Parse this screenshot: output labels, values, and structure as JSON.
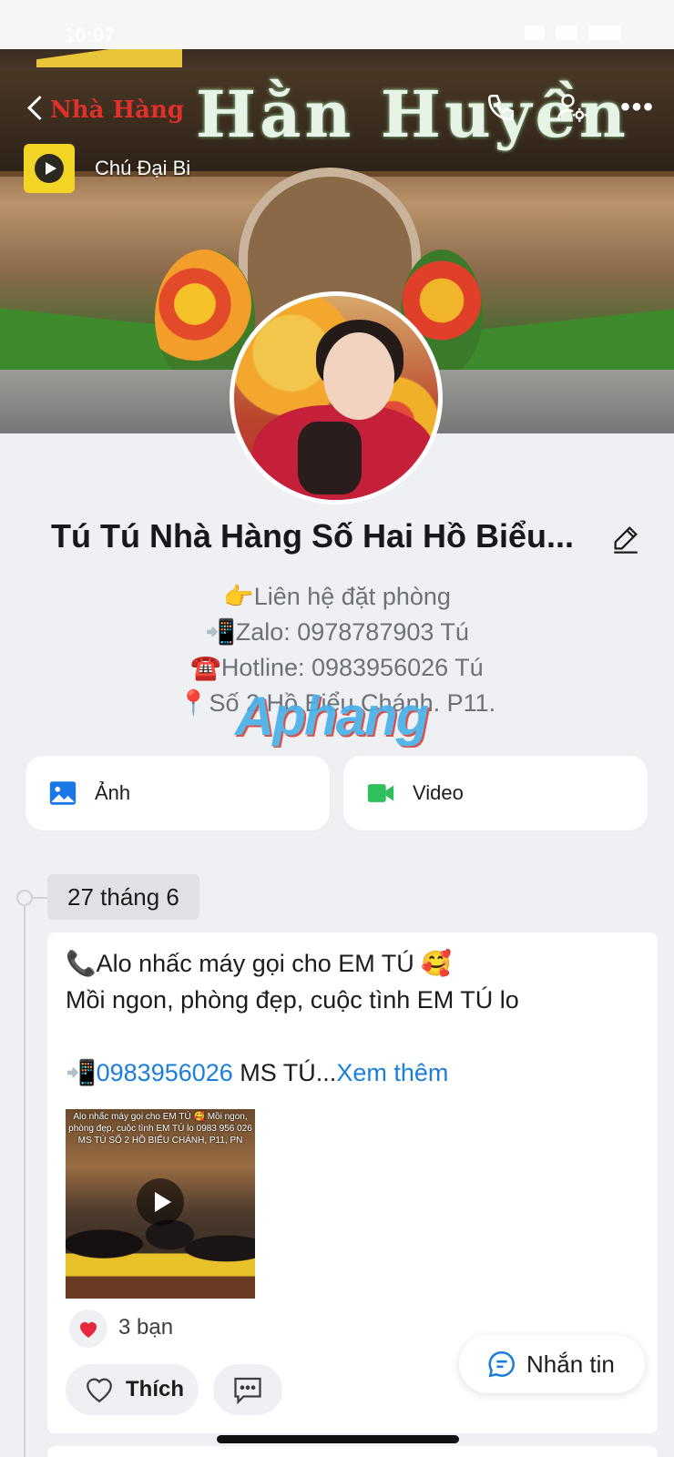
{
  "status_bar": {
    "time": "10:07"
  },
  "cover": {
    "sign_text": "Hằn Huyền",
    "sign_left": "Nhà Hàng"
  },
  "music": {
    "title": "Chú Đại Bi"
  },
  "profile": {
    "name": "Tú Tú Nhà Hàng Số Hai Hồ Biểu...",
    "bio": [
      "👉Liên hệ đặt phòng",
      "📲Zalo: 0978787903 Tú",
      "☎️Hotline: 0983956026 Tú",
      "📍Số 2 Hồ Biểu Chánh. P11."
    ]
  },
  "watermark": "Aphang",
  "media": {
    "photo_label": "Ảnh",
    "video_label": "Video"
  },
  "timeline": {
    "date": "27 tháng 6"
  },
  "post": {
    "line1": "📞Alo nhấc máy gọi cho EM TÚ 🥰",
    "line2": "Mồi ngon, phòng đẹp, cuộc tình EM TÚ lo",
    "phone_prefix": "📲",
    "phone": "0983956026",
    "phone_suffix": " MS TÚ...",
    "see_more": "Xem thêm",
    "video_caption": "Alo nhấc máy gọi cho EM TÚ 🥰 Mồi ngon, phòng đẹp, cuộc tình EM TÚ lo 0983 956 026 MS TÚ SỐ 2 HỒ BIỂU CHÁNH, P11, PN",
    "reaction_count": "3 bạn",
    "like_label": "Thích"
  },
  "fab": {
    "message_label": "Nhắn tin"
  },
  "colors": {
    "accent_blue": "#1a7fdc",
    "photo_icon": "#1977e8",
    "video_icon": "#2fbf5d",
    "heart": "#e8283c"
  }
}
